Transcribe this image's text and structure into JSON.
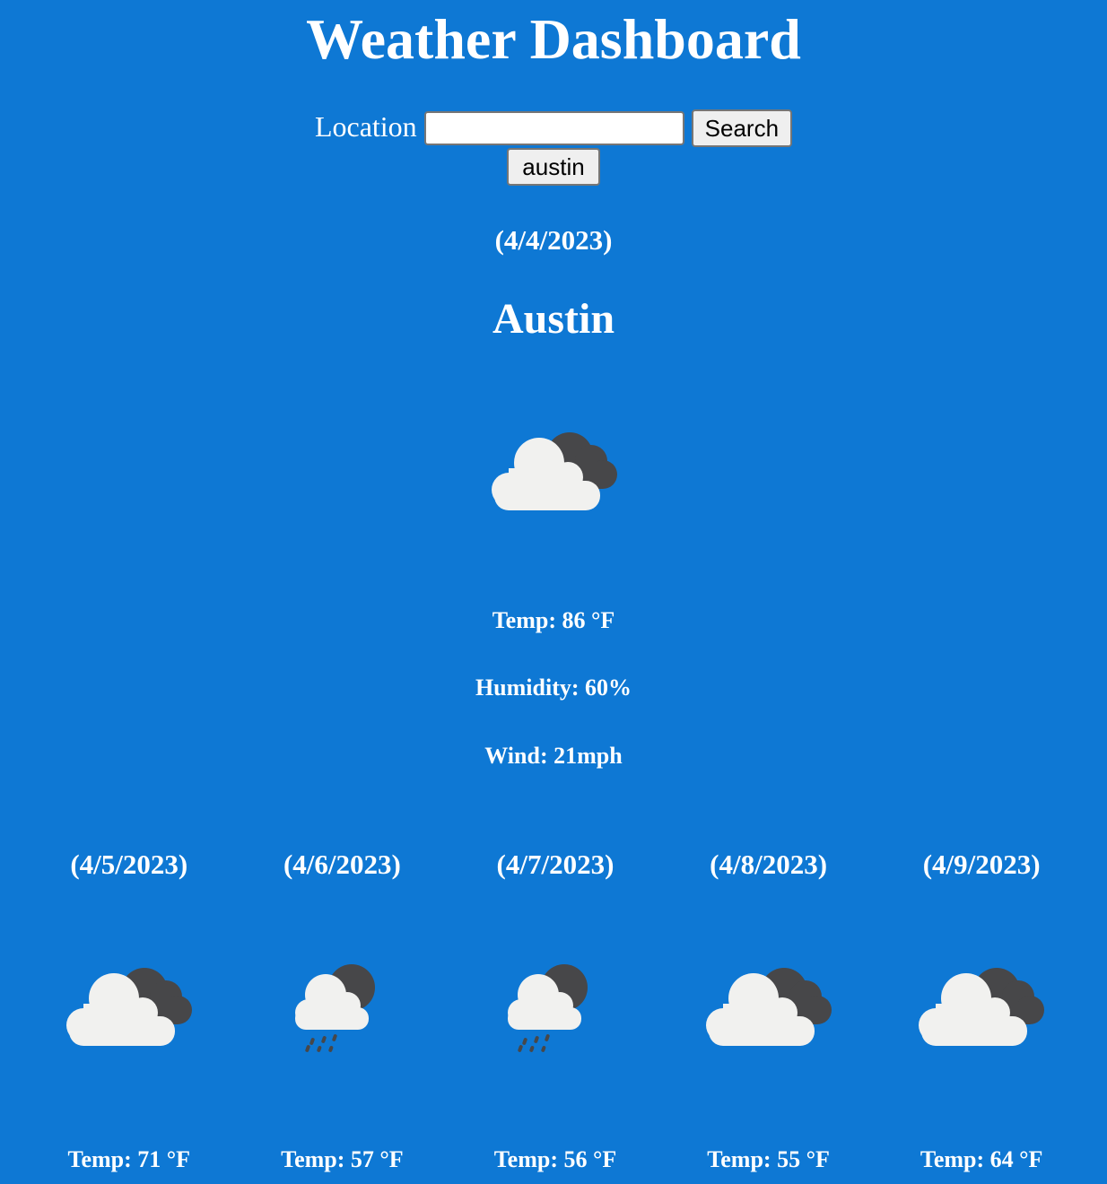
{
  "header": {
    "title": "Weather Dashboard"
  },
  "search": {
    "label": "Location",
    "value": "",
    "button_label": "Search"
  },
  "history": [
    "austin"
  ],
  "current": {
    "date": "(4/4/2023)",
    "city": "Austin",
    "icon": "partly-cloudy-icon",
    "temp": "Temp: 86 °F",
    "humidity": "Humidity: 60%",
    "wind": "Wind: 21mph"
  },
  "forecast": [
    {
      "date": "(4/5/2023)",
      "icon": "partly-cloudy-icon",
      "temp": "Temp: 71 °F"
    },
    {
      "date": "(4/6/2023)",
      "icon": "rain-cloud-icon",
      "temp": "Temp: 57 °F"
    },
    {
      "date": "(4/7/2023)",
      "icon": "rain-cloud-icon",
      "temp": "Temp: 56 °F"
    },
    {
      "date": "(4/8/2023)",
      "icon": "partly-cloudy-icon",
      "temp": "Temp: 55 °F"
    },
    {
      "date": "(4/9/2023)",
      "icon": "partly-cloudy-icon",
      "temp": "Temp: 64 °F"
    }
  ],
  "colors": {
    "background": "#0e78d4",
    "text": "#ffffff",
    "cloud_light": "#f1f1ef",
    "cloud_dark": "#474749"
  }
}
